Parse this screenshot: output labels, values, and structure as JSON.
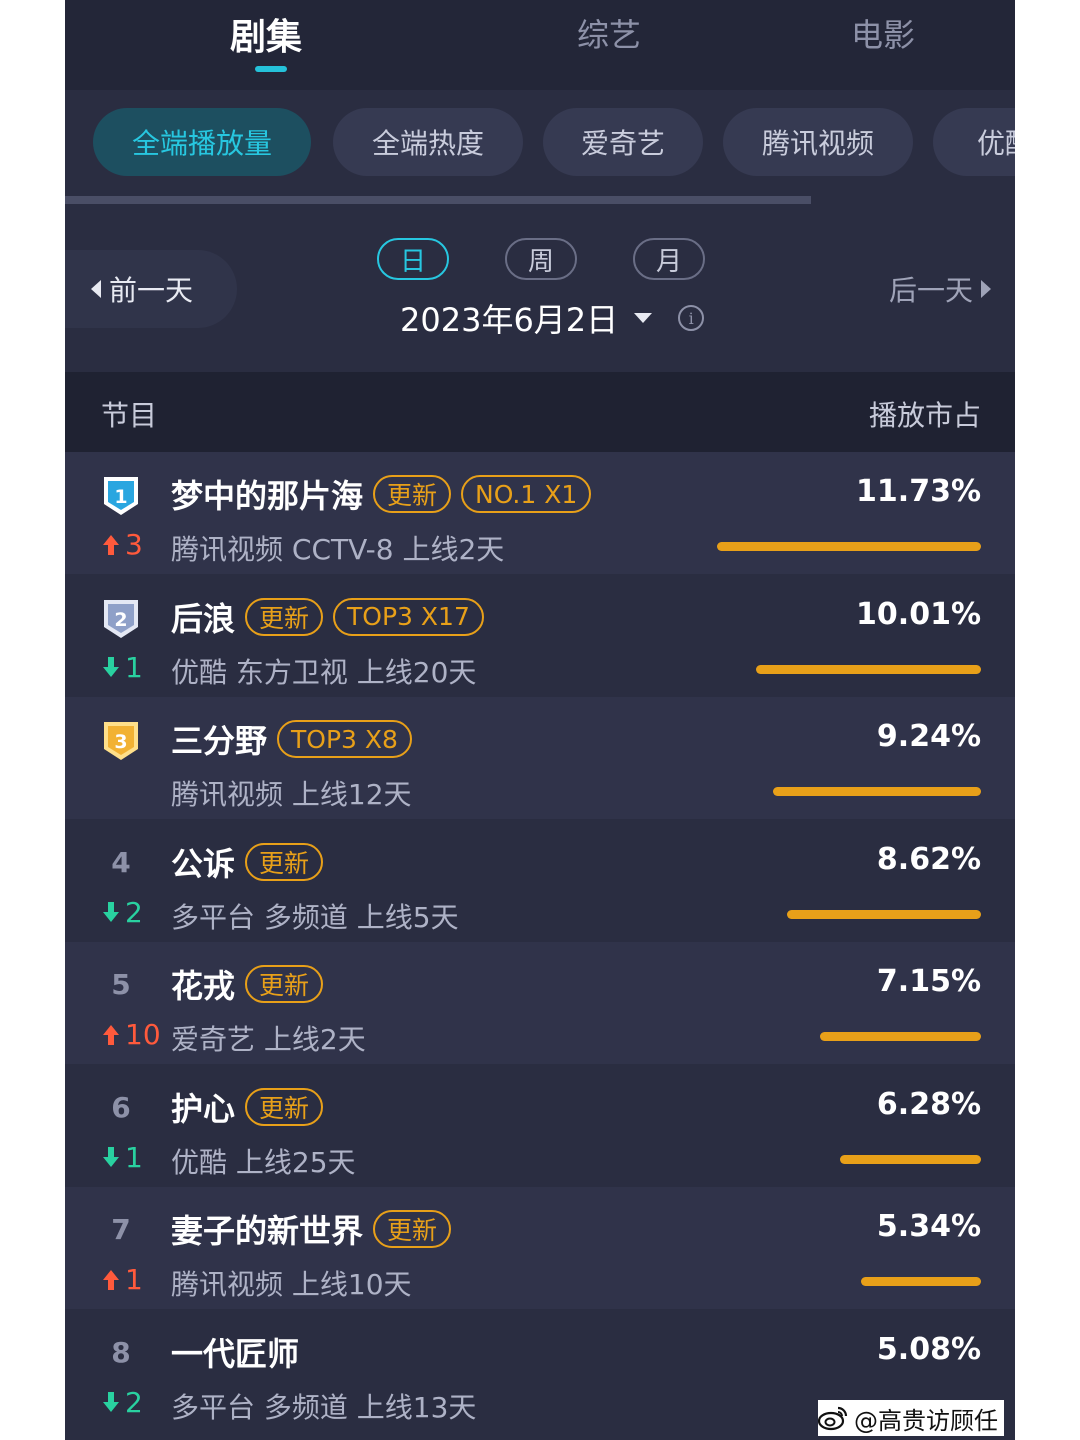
{
  "category_tabs": [
    {
      "label": "剧集",
      "active": true
    },
    {
      "label": "综艺",
      "active": false
    },
    {
      "label": "电影",
      "active": false
    }
  ],
  "platform_pills": [
    {
      "label": "全端播放量",
      "active": true
    },
    {
      "label": "全端热度",
      "active": false
    },
    {
      "label": "爱奇艺",
      "active": false
    },
    {
      "label": "腾讯视频",
      "active": false
    },
    {
      "label": "优酷",
      "active": false
    }
  ],
  "date_nav": {
    "prev_label": "前一天",
    "next_label": "后一天",
    "periods": [
      "日",
      "周",
      "月"
    ],
    "active_period": "日",
    "date": "2023年6月2日",
    "info_icon": "i"
  },
  "table_header": {
    "left": "节目",
    "right": "播放市占"
  },
  "rows": [
    {
      "rank": "1",
      "badge": "gold-blue",
      "change_dir": "up",
      "change": "3",
      "title": "梦中的那片海",
      "tags": [
        "更新",
        "NO.1 X1"
      ],
      "subtitle": "腾讯视频 CCTV-8 上线2天",
      "share": "11.73%",
      "share_value": 11.73
    },
    {
      "rank": "2",
      "badge": "silver",
      "change_dir": "down",
      "change": "1",
      "title": "后浪",
      "tags": [
        "更新",
        "TOP3 X17"
      ],
      "subtitle": "优酷 东方卫视 上线20天",
      "share": "10.01%",
      "share_value": 10.01
    },
    {
      "rank": "3",
      "badge": "gold",
      "change_dir": "",
      "change": "",
      "title": "三分野",
      "tags": [
        "TOP3 X8"
      ],
      "subtitle": "腾讯视频 上线12天",
      "share": "9.24%",
      "share_value": 9.24
    },
    {
      "rank": "4",
      "badge": "",
      "change_dir": "down",
      "change": "2",
      "title": "公诉",
      "tags": [
        "更新"
      ],
      "subtitle": "多平台 多频道 上线5天",
      "share": "8.62%",
      "share_value": 8.62
    },
    {
      "rank": "5",
      "badge": "",
      "change_dir": "up",
      "change": "10",
      "title": "花戎",
      "tags": [
        "更新"
      ],
      "subtitle": "爱奇艺 上线2天",
      "share": "7.15%",
      "share_value": 7.15
    },
    {
      "rank": "6",
      "badge": "",
      "change_dir": "down",
      "change": "1",
      "title": "护心",
      "tags": [
        "更新"
      ],
      "subtitle": "优酷 上线25天",
      "share": "6.28%",
      "share_value": 6.28
    },
    {
      "rank": "7",
      "badge": "",
      "change_dir": "up",
      "change": "1",
      "title": "妻子的新世界",
      "tags": [
        "更新"
      ],
      "subtitle": "腾讯视频 上线10天",
      "share": "5.34%",
      "share_value": 5.34
    },
    {
      "rank": "8",
      "badge": "",
      "change_dir": "down",
      "change": "2",
      "title": "一代匠师",
      "tags": [],
      "subtitle": "多平台 多频道 上线13天",
      "share": "5.08%",
      "share_value": 5.08
    }
  ],
  "watermark_credit": "@高贵访顾任",
  "colors": {
    "accent_cyan": "#27c7e0",
    "tag_gold": "#e8a019",
    "up_red": "#ff5a3c",
    "down_green": "#29d1a0",
    "bg": "#2a2d41"
  }
}
